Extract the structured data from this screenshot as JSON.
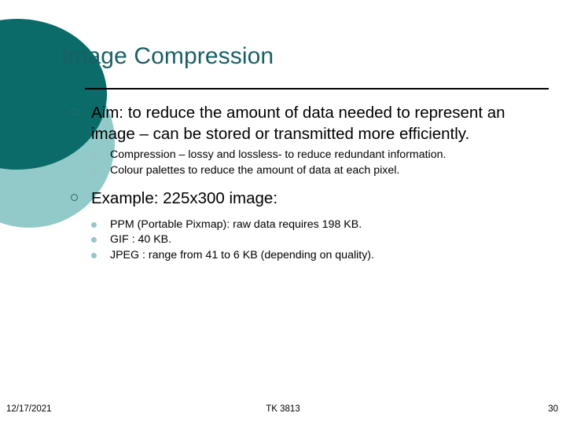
{
  "slide": {
    "title": "Image Compression",
    "accent_color_dark": "#0a6b69",
    "accent_color_light": "#92c9c9",
    "title_color": "#1a5f63",
    "body_color": "#000000",
    "background_color": "#ffffff"
  },
  "content": {
    "bullets": [
      {
        "text": "Aim: to reduce the amount of data needed to represent an image – can be stored or transmitted more efficiently.",
        "sub": [
          "Compression – lossy and lossless- to reduce redundant information.",
          "Colour palettes to reduce the amount of data at each pixel."
        ]
      },
      {
        "text": "Example: 225x300 image:",
        "sub": [
          "PPM (Portable Pixmap): raw data requires 198 KB.",
          "GIF : 40 KB.",
          "JPEG : range from 41 to 6 KB (depending on quality)."
        ]
      }
    ]
  },
  "footer": {
    "date": "12/17/2021",
    "course": "TK 3813",
    "page_number": "30"
  }
}
